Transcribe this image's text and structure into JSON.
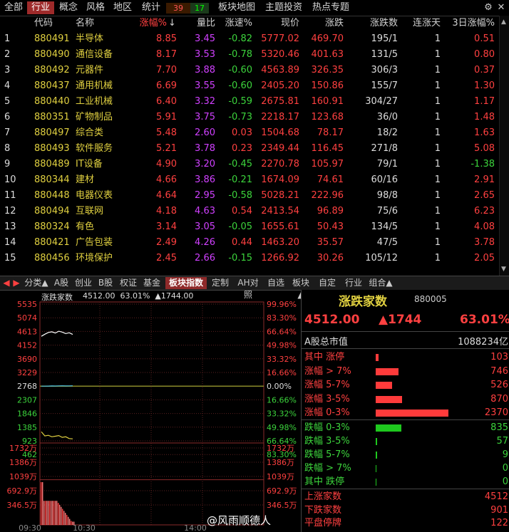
{
  "top_tabs": [
    {
      "label": "全部",
      "active": false
    },
    {
      "label": "行业",
      "active": true
    },
    {
      "label": "概念",
      "active": false
    },
    {
      "label": "风格",
      "active": false
    },
    {
      "label": "地区",
      "active": false
    },
    {
      "label": "统计",
      "active": false
    }
  ],
  "counts": {
    "up": "39",
    "down": "17"
  },
  "top_links": [
    "板块地图",
    "主题投资",
    "热点专题"
  ],
  "table": {
    "headers": [
      "",
      "代码",
      "名称",
      "涨幅%",
      "量比",
      "涨速%",
      "现价",
      "涨跌",
      "涨跌数",
      "连涨天",
      "3日涨幅%"
    ],
    "sort_mark": "↓",
    "rows": [
      {
        "idx": "1",
        "code": "880491",
        "name": "半导体",
        "pct": "8.85",
        "vr": "3.45",
        "spd": "-0.82",
        "price": "5777.02",
        "chg": "469.70",
        "ratio": "195/1",
        "days": "1",
        "d3": "0.51"
      },
      {
        "idx": "2",
        "code": "880490",
        "name": "通信设备",
        "pct": "8.17",
        "vr": "3.53",
        "spd": "-0.78",
        "price": "5320.46",
        "chg": "401.63",
        "ratio": "131/5",
        "days": "1",
        "d3": "0.80"
      },
      {
        "idx": "3",
        "code": "880492",
        "name": "元器件",
        "pct": "7.70",
        "vr": "3.88",
        "spd": "-0.60",
        "price": "4563.89",
        "chg": "326.35",
        "ratio": "306/3",
        "days": "1",
        "d3": "0.37"
      },
      {
        "idx": "4",
        "code": "880437",
        "name": "通用机械",
        "pct": "6.69",
        "vr": "3.55",
        "spd": "-0.60",
        "price": "2405.20",
        "chg": "150.86",
        "ratio": "155/7",
        "days": "1",
        "d3": "1.30"
      },
      {
        "idx": "5",
        "code": "880440",
        "name": "工业机械",
        "pct": "6.40",
        "vr": "3.32",
        "spd": "-0.59",
        "price": "2675.81",
        "chg": "160.91",
        "ratio": "304/27",
        "days": "1",
        "d3": "1.17"
      },
      {
        "idx": "6",
        "code": "880351",
        "name": "矿物制品",
        "pct": "5.91",
        "vr": "3.75",
        "spd": "-0.73",
        "price": "2218.17",
        "chg": "123.68",
        "ratio": "36/0",
        "days": "1",
        "d3": "1.48"
      },
      {
        "idx": "7",
        "code": "880497",
        "name": "综合类",
        "pct": "5.48",
        "vr": "2.60",
        "spd": "0.03",
        "price": "1504.68",
        "chg": "78.17",
        "ratio": "18/2",
        "days": "1",
        "d3": "1.63"
      },
      {
        "idx": "8",
        "code": "880493",
        "name": "软件服务",
        "pct": "5.21",
        "vr": "3.78",
        "spd": "0.23",
        "price": "2349.44",
        "chg": "116.45",
        "ratio": "271/8",
        "days": "1",
        "d3": "5.08"
      },
      {
        "idx": "9",
        "code": "880489",
        "name": "IT设备",
        "pct": "4.90",
        "vr": "3.20",
        "spd": "-0.45",
        "price": "2270.78",
        "chg": "105.97",
        "ratio": "79/1",
        "days": "1",
        "d3": "-1.38"
      },
      {
        "idx": "10",
        "code": "880344",
        "name": "建材",
        "pct": "4.66",
        "vr": "3.86",
        "spd": "-0.21",
        "price": "1674.09",
        "chg": "74.61",
        "ratio": "60/16",
        "days": "1",
        "d3": "2.91"
      },
      {
        "idx": "11",
        "code": "880448",
        "name": "电器仪表",
        "pct": "4.64",
        "vr": "2.95",
        "spd": "-0.58",
        "price": "5028.21",
        "chg": "222.96",
        "ratio": "98/8",
        "days": "1",
        "d3": "2.65"
      },
      {
        "idx": "12",
        "code": "880494",
        "name": "互联网",
        "pct": "4.18",
        "vr": "4.63",
        "spd": "0.54",
        "price": "2413.54",
        "chg": "96.89",
        "ratio": "75/6",
        "days": "1",
        "d3": "6.23"
      },
      {
        "idx": "13",
        "code": "880324",
        "name": "有色",
        "pct": "3.14",
        "vr": "3.05",
        "spd": "-0.05",
        "price": "1655.61",
        "chg": "50.43",
        "ratio": "134/5",
        "days": "1",
        "d3": "4.08"
      },
      {
        "idx": "14",
        "code": "880421",
        "name": "广告包装",
        "pct": "2.49",
        "vr": "4.26",
        "spd": "0.44",
        "price": "1463.20",
        "chg": "35.57",
        "ratio": "47/5",
        "days": "1",
        "d3": "3.78"
      },
      {
        "idx": "15",
        "code": "880456",
        "name": "环境保护",
        "pct": "2.45",
        "vr": "2.66",
        "spd": "-0.15",
        "price": "1266.92",
        "chg": "30.26",
        "ratio": "105/12",
        "days": "1",
        "d3": "2.05"
      }
    ]
  },
  "bottom_tabs": [
    {
      "label": "分类▲",
      "active": false
    },
    {
      "label": "A股",
      "active": false
    },
    {
      "label": "创业",
      "active": false
    },
    {
      "label": "B股",
      "active": false
    },
    {
      "label": "权证",
      "active": false
    },
    {
      "label": "基金",
      "active": false
    },
    {
      "label": "板块指数",
      "active": true
    },
    {
      "label": "定制",
      "active": false
    },
    {
      "label": "AH对照",
      "active": false
    },
    {
      "label": "自选",
      "active": false
    },
    {
      "label": "板块▲",
      "active": false
    },
    {
      "label": "自定▲",
      "active": false
    },
    {
      "label": "行业▲",
      "active": false
    },
    {
      "label": "组合▲",
      "active": false
    }
  ],
  "chart": {
    "header_name": "涨跌家数",
    "header_values": "4512.00  63.01%  ▲1744.00",
    "left_axis": [
      "5535",
      "5074",
      "4613",
      "4152",
      "3690",
      "3229",
      "2768",
      "2307",
      "1846",
      "1385",
      "923",
      "462"
    ],
    "right_axis": [
      "99.96%",
      "83.30%",
      "66.64%",
      "49.98%",
      "33.32%",
      "16.66%",
      "0.00%",
      "16.66%",
      "33.32%",
      "49.98%",
      "66.64%",
      "83.30%"
    ],
    "vol_left_axis": [
      "1732万",
      "1386万",
      "1039万",
      "692.9万",
      "346.5万"
    ],
    "vol_right_axis": [
      "1732万",
      "1386万",
      "1039万",
      "692.9万",
      "346.5万"
    ],
    "time_labels": [
      "09:30",
      "10:30",
      "14:00"
    ]
  },
  "chart_data": {
    "type": "line",
    "title": "涨跌家数",
    "xlabel": "",
    "ylabel": "",
    "ylim": [
      462,
      5535
    ],
    "series": [
      {
        "values": [
          4450,
          4520,
          4580,
          4600,
          4560,
          4620,
          4590,
          4540,
          4570,
          4512
        ]
      },
      {
        "values": [
          2768,
          2768,
          2770,
          2775,
          2772,
          2778,
          2780,
          2776,
          2778,
          2780
        ]
      },
      {
        "values": [
          1230,
          1090,
          1110,
          1060,
          1080,
          1100,
          1040,
          1060,
          1000,
          990
        ]
      }
    ]
  },
  "panel": {
    "title": "涨跌家数",
    "code": "880005",
    "price": "4512.00",
    "change": "▲1744",
    "pct": "63.01%",
    "mcap_label": "A股总市值",
    "mcap_value": "1088234亿",
    "up_rows": [
      {
        "label": "其中 涨停",
        "value": "103",
        "fraction": 0.043
      },
      {
        "label": "涨幅 > 7%",
        "value": "746",
        "fraction": 0.315
      },
      {
        "label": "涨幅 5-7%",
        "value": "526",
        "fraction": 0.222
      },
      {
        "label": "涨幅 3-5%",
        "value": "870",
        "fraction": 0.367
      },
      {
        "label": "涨幅 0-3%",
        "value": "2370",
        "fraction": 1.0
      }
    ],
    "down_rows": [
      {
        "label": "跌幅 0-3%",
        "value": "835",
        "fraction": 0.352
      },
      {
        "label": "跌幅 3-5%",
        "value": "57",
        "fraction": 0.024
      },
      {
        "label": "跌幅 5-7%",
        "value": "9",
        "fraction": 0.004
      },
      {
        "label": "跌幅 > 7%",
        "value": "0",
        "fraction": 0
      },
      {
        "label": "其中 跌停",
        "value": "0",
        "fraction": 0
      }
    ],
    "summary": [
      {
        "label": "上涨家数",
        "value": "4512"
      },
      {
        "label": "下跌家数",
        "value": "901"
      },
      {
        "label": "平盘停牌",
        "value": "122"
      }
    ]
  },
  "watermark": "@风雨顺德人",
  "colors": {
    "up": "#ff4040",
    "down": "#3cd43c",
    "accent": "#e0d040",
    "volume": "#d040ff"
  }
}
